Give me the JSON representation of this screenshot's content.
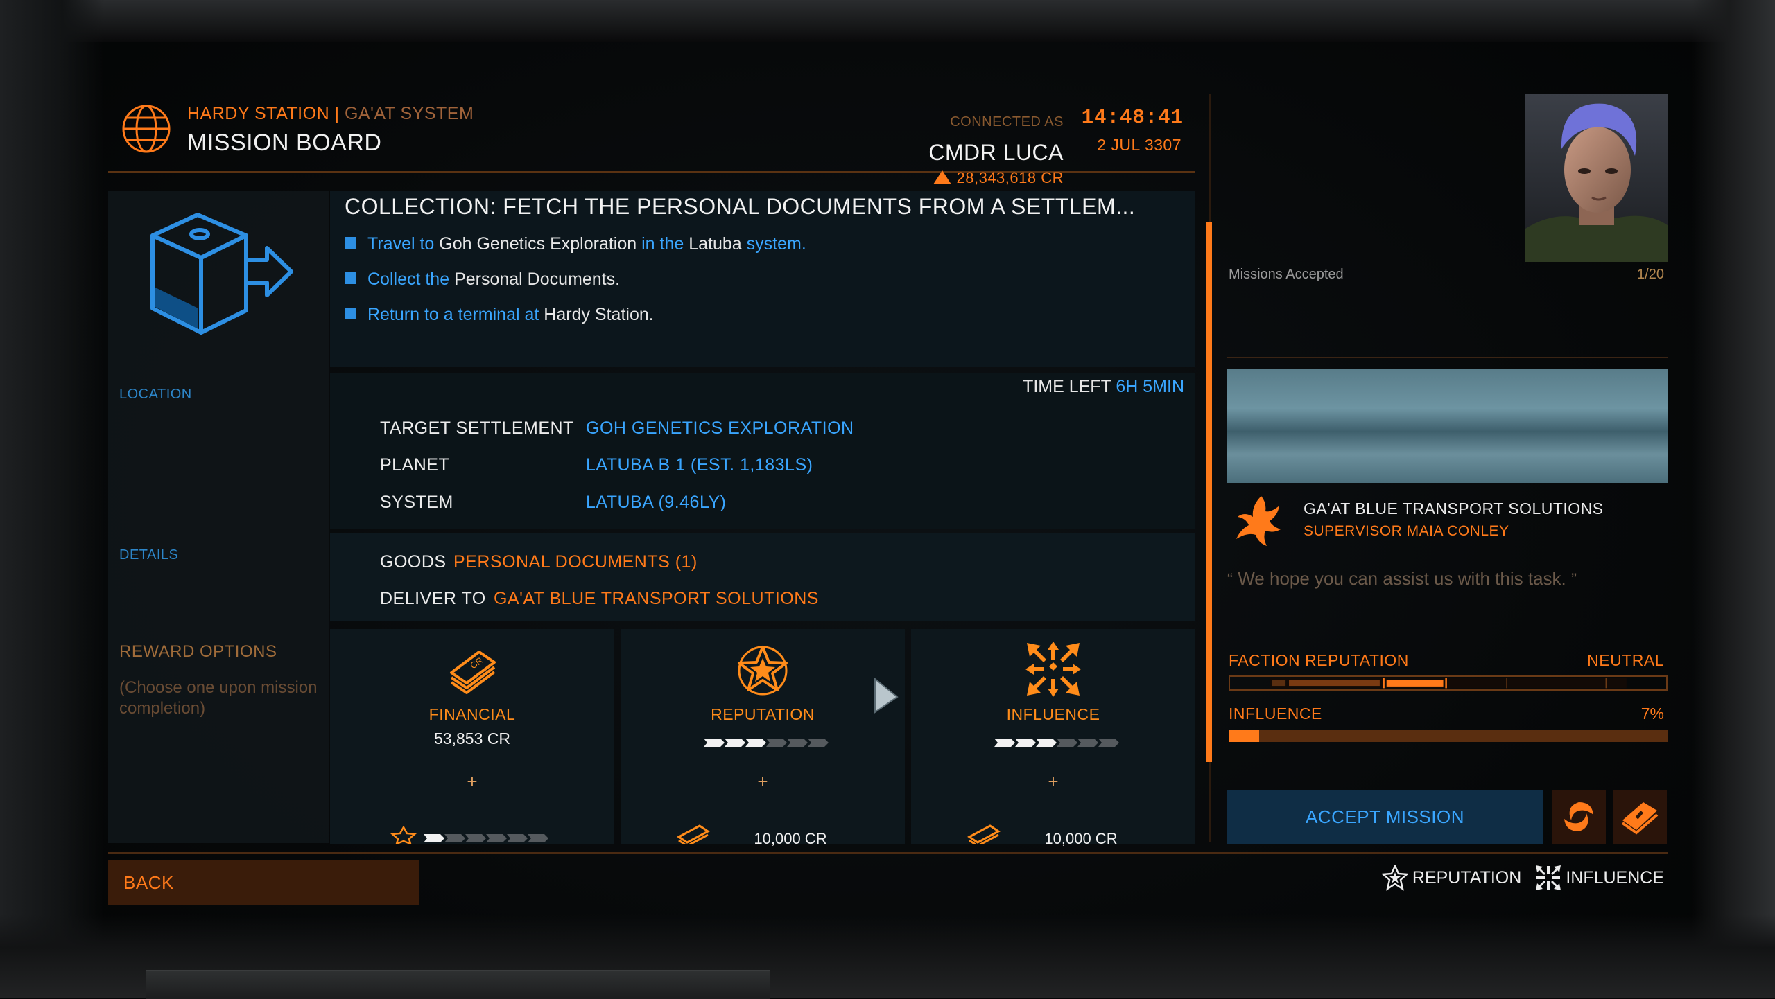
{
  "header": {
    "station": "HARDY STATION",
    "separator": " | ",
    "system": "GA'AT SYSTEM",
    "title": "MISSION BOARD",
    "time": "14:48:41",
    "date": "2 JUL 3307"
  },
  "mission": {
    "title": "COLLECTION: FETCH THE PERSONAL DOCUMENTS FROM A SETTLEM...",
    "objectives": [
      {
        "a": "Travel to ",
        "b": "Goh Genetics Exploration",
        "c": " in the ",
        "d": "Latuba",
        "e": " system."
      },
      {
        "a": "Collect the ",
        "b": "Personal Documents",
        "c": "."
      },
      {
        "a": "Return to a terminal at ",
        "b": "Hardy Station",
        "c": "."
      }
    ]
  },
  "location": {
    "section_label": "LOCATION",
    "time_left_label": "TIME LEFT",
    "time_left_value": "6H 5MIN",
    "rows": [
      {
        "key": "TARGET SETTLEMENT",
        "value": "GOH GENETICS EXPLORATION"
      },
      {
        "key": "PLANET",
        "value": "LATUBA B 1 (EST. 1,183LS)"
      },
      {
        "key": "SYSTEM",
        "value": "LATUBA (9.46LY)"
      }
    ]
  },
  "details": {
    "section_label": "DETAILS",
    "goods_label": "GOODS",
    "goods_value": "PERSONAL DOCUMENTS (1)",
    "deliver_label": "DELIVER TO",
    "deliver_value": "GA'AT BLUE TRANSPORT SOLUTIONS"
  },
  "rewards": {
    "section_label": "REWARD OPTIONS",
    "note": "(Choose one upon mission completion)",
    "options": [
      {
        "label": "FINANCIAL",
        "value": "53,853 CR",
        "plus": "+",
        "sub": "",
        "level": 1,
        "icon": "credits-icon"
      },
      {
        "label": "REPUTATION",
        "value": "",
        "plus": "+",
        "sub": "10,000 CR",
        "level": 3,
        "icon": "reputation-star-icon"
      },
      {
        "label": "INFLUENCE",
        "value": "",
        "plus": "+",
        "sub": "10,000 CR",
        "level": 3,
        "icon": "influence-icon"
      }
    ],
    "bar_segments": 6
  },
  "commander": {
    "connected_label": "CONNECTED AS",
    "name": "CMDR LUCA",
    "credits": "28,343,618 CR",
    "missions_label": "Missions Accepted",
    "missions_count": "1/20"
  },
  "faction": {
    "name": "GA'AT BLUE TRANSPORT SOLUTIONS",
    "contact": "SUPERVISOR MAIA CONLEY",
    "quote": "We hope you can assist us with this task.",
    "reputation_label": "FACTION REPUTATION",
    "reputation_value": "NEUTRAL",
    "influence_label": "INFLUENCE",
    "influence_value": "7%",
    "influence_fraction": 0.07
  },
  "actions": {
    "accept_label": "ACCEPT MISSION",
    "back_label": "BACK",
    "legend_reputation": "REPUTATION",
    "legend_influence": "INFLUENCE"
  },
  "colors": {
    "accent_orange": "#ff7a1a",
    "accent_blue": "#3aa6ff"
  }
}
